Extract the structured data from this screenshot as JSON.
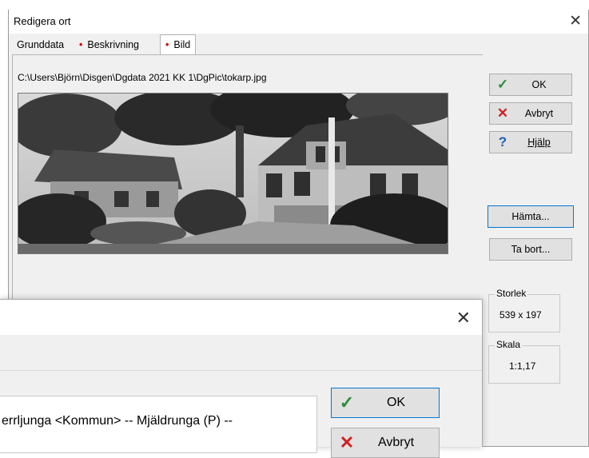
{
  "dialog_main": {
    "title": "Redigera ort",
    "tabs": [
      {
        "label": "Grunddata"
      },
      {
        "label": "Beskrivning"
      },
      {
        "label": "Bild"
      }
    ],
    "file_path": "C:\\Users\\Björn\\Disgen\\Dgdata 2021 KK 1\\DgPic\\tokarp.jpg",
    "buttons": {
      "ok": "OK",
      "cancel": "Avbryt",
      "help": "Hjälp",
      "fetch": "Hämta...",
      "remove": "Ta bort..."
    },
    "size_group": {
      "caption": "Storlek",
      "value": "539 x 197"
    },
    "scale_group": {
      "caption": "Skala",
      "value": "1:1,17"
    }
  },
  "dialog_front": {
    "place_text": "errljunga <Kommun> -- Mjäldrunga (P) --",
    "buttons": {
      "ok": "OK",
      "cancel": "Avbryt"
    }
  },
  "colors": {
    "check": "#2e8b3a",
    "cross": "#d02020",
    "help": "#1a5fb4",
    "focus": "#0078d7"
  },
  "icons": [
    "close-icon",
    "check-icon",
    "cross-icon",
    "question-icon"
  ]
}
